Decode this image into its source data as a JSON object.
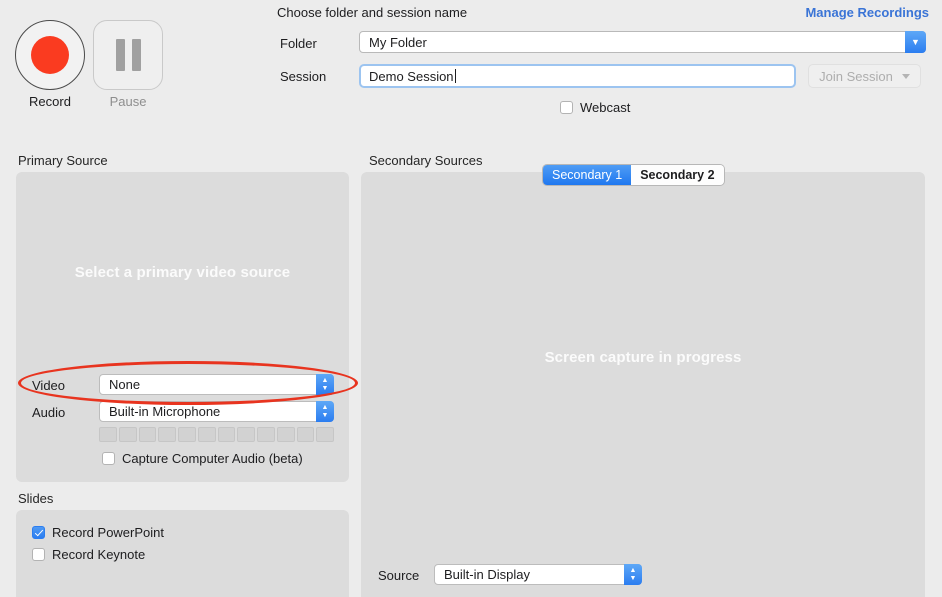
{
  "transport": {
    "record_label": "Record",
    "pause_label": "Pause",
    "record_icon": "record-circle-icon",
    "pause_icon": "pause-bars-icon"
  },
  "header": {
    "title": "Choose folder and session name",
    "manage_link": "Manage Recordings",
    "folder_label": "Folder",
    "folder_value": "My Folder",
    "session_label": "Session",
    "session_value": "Demo Session",
    "join_button": "Join Session",
    "webcast_label": "Webcast",
    "webcast_checked": false
  },
  "primary": {
    "section_title": "Primary Source",
    "preview_text": "Select a primary video source",
    "video_label": "Video",
    "video_value": "None",
    "audio_label": "Audio",
    "audio_value": "Built-in Microphone",
    "level_segments": 12,
    "capture_audio_label": "Capture Computer Audio (beta)",
    "capture_audio_checked": false
  },
  "slides": {
    "section_title": "Slides",
    "items": [
      {
        "label": "Record PowerPoint",
        "checked": true
      },
      {
        "label": "Record Keynote",
        "checked": false
      }
    ]
  },
  "secondary": {
    "section_title": "Secondary Sources",
    "tabs": [
      {
        "label": "Secondary 1",
        "active": true
      },
      {
        "label": "Secondary 2",
        "active": false
      }
    ],
    "preview_text": "Screen capture in progress",
    "source_label": "Source",
    "source_value": "Built-in Display"
  },
  "annotation": {
    "type": "ellipse-highlight",
    "color": "#e8341f",
    "target": "video-source-popup"
  },
  "colors": {
    "background": "#ececec",
    "panel": "#dcdcdc",
    "accent_blue": "#2b7df0",
    "link_blue": "#3a74d6",
    "record_red": "#fa3b20",
    "annotation_red": "#e8341f"
  }
}
